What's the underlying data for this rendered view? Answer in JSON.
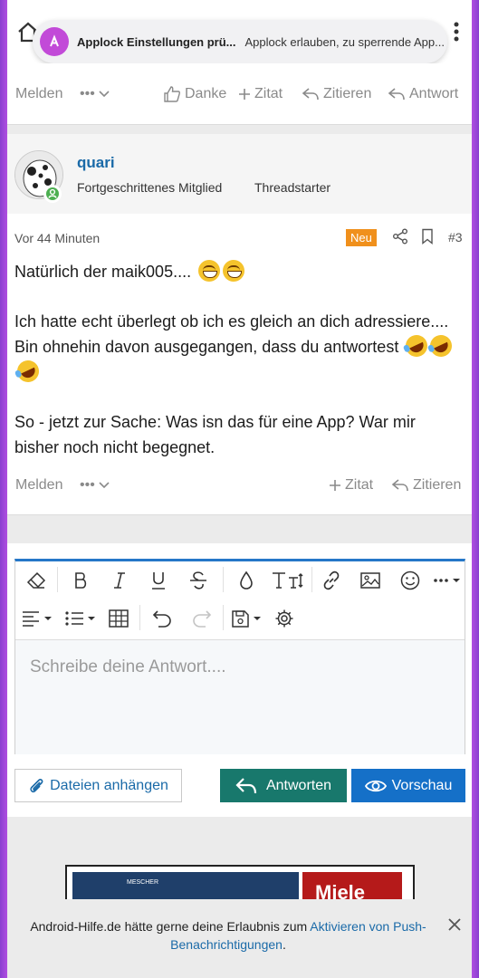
{
  "toast": {
    "title": "Applock Einstellungen prü...",
    "text": "Applock erlauben, zu sperrende App..."
  },
  "actions_top": {
    "report": "Melden",
    "more": "•••",
    "like": "Danke",
    "quote": "Zitat",
    "quote_reply": "Zitieren",
    "reply": "Antwort"
  },
  "author": {
    "name": "quari",
    "role": "Fortgeschrittenes Mitglied",
    "tag": "Threadstarter"
  },
  "post": {
    "date": "Vor 44 Minuten",
    "badge": "Neu",
    "number": "#3",
    "line1": "Natürlich der maik005....",
    "para2": "Ich hatte echt überlegt ob ich es gleich an dich adressiere.... Bin ohnehin davon ausgegangen, dass du antwortest",
    "para3": "So - jetzt zur Sache: Was isn das für eine App? War mir bisher noch nicht begegnet."
  },
  "actions_post": {
    "report": "Melden",
    "more": "•••",
    "quote": "Zitat",
    "quote_reply": "Zitieren"
  },
  "editor": {
    "placeholder": "Schreibe deine Antwort....",
    "attach": "Dateien anhängen",
    "reply": "Antworten",
    "preview": "Vorschau"
  },
  "notify": {
    "text_before": "Android-Hilfe.de hätte gerne deine Erlaubnis zum ",
    "link": "Aktivieren von Push-Benachrichtigungen",
    "text_after": "."
  },
  "ad": {
    "brand": "Miele",
    "small": "MESCHER"
  },
  "colors": {
    "accent": "#1a6aa8",
    "reply_btn": "#18786c",
    "preview_btn": "#1570c8",
    "new_badge": "#f0901c",
    "online": "#4caf50"
  }
}
